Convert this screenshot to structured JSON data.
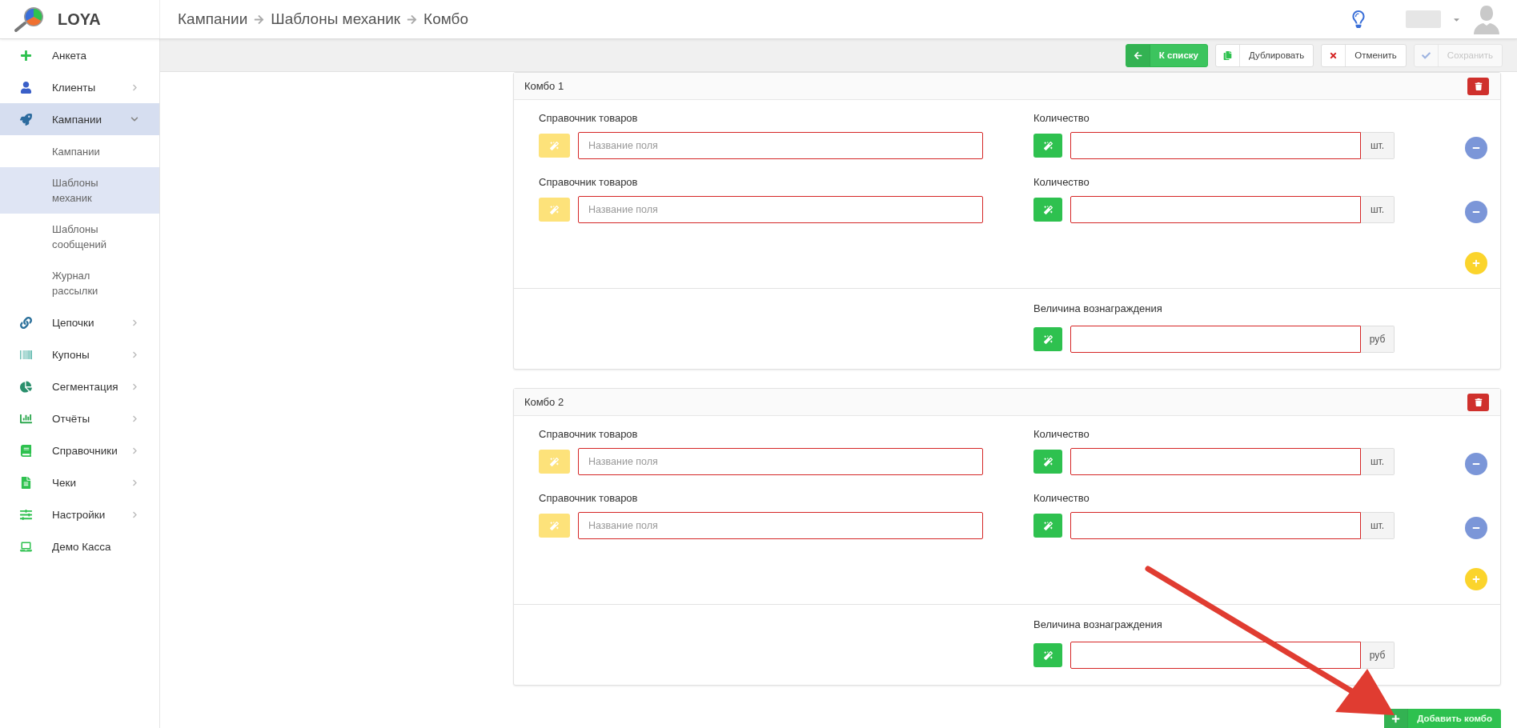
{
  "header": {
    "logo": "LOYA",
    "breadcrumb": [
      "Кампании",
      "Шаблоны механик",
      "Комбо"
    ]
  },
  "sidebar": {
    "items": [
      {
        "label": "Анкета",
        "expandable": false,
        "selected": false
      },
      {
        "label": "Клиенты",
        "expandable": true,
        "expanded": false,
        "selected": false
      },
      {
        "label": "Кампании",
        "expandable": true,
        "expanded": true,
        "selected": true,
        "children": [
          {
            "label": "Кампании",
            "selected": false
          },
          {
            "label": "Шаблоны механик",
            "selected": true
          },
          {
            "label": "Шаблоны сообщений",
            "selected": false
          },
          {
            "label": "Журнал рассылки",
            "selected": false
          }
        ]
      },
      {
        "label": "Цепочки",
        "expandable": true,
        "expanded": false,
        "selected": false
      },
      {
        "label": "Купоны",
        "expandable": true,
        "expanded": false,
        "selected": false
      },
      {
        "label": "Сегментация",
        "expandable": true,
        "expanded": false,
        "selected": false
      },
      {
        "label": "Отчёты",
        "expandable": true,
        "expanded": false,
        "selected": false
      },
      {
        "label": "Справочники",
        "expandable": true,
        "expanded": false,
        "selected": false
      },
      {
        "label": "Чеки",
        "expandable": true,
        "expanded": false,
        "selected": false
      },
      {
        "label": "Настройки",
        "expandable": true,
        "expanded": false,
        "selected": false
      },
      {
        "label": "Демо Касса",
        "expandable": false,
        "selected": false
      }
    ]
  },
  "toolbar": {
    "buttons": [
      {
        "kind": "back",
        "label": "К списку",
        "disabled": false
      },
      {
        "kind": "duplicate",
        "label": "Дублировать",
        "disabled": false
      },
      {
        "kind": "cancel",
        "label": "Отменить",
        "disabled": false
      },
      {
        "kind": "save",
        "label": "Сохранить",
        "disabled": true
      }
    ]
  },
  "combos": [
    {
      "title": "Комбо 1",
      "rows": [
        {
          "product_label": "Справочник товаров",
          "placeholder": "Название поля",
          "quantity_label": "Количество",
          "unit": "шт."
        },
        {
          "product_label": "Справочник товаров",
          "placeholder": "Название поля",
          "quantity_label": "Количество",
          "unit": "шт."
        }
      ],
      "reward": {
        "label": "Величина вознаграждения",
        "unit": "руб"
      }
    },
    {
      "title": "Комбо 2",
      "rows": [
        {
          "product_label": "Справочник товаров",
          "placeholder": "Название поля",
          "quantity_label": "Количество",
          "unit": "шт."
        },
        {
          "product_label": "Справочник товаров",
          "placeholder": "Название поля",
          "quantity_label": "Количество",
          "unit": "шт."
        }
      ],
      "reward": {
        "label": "Величина вознаграждения",
        "unit": "руб"
      }
    }
  ],
  "add_button": {
    "label": "Добавить комбо"
  }
}
